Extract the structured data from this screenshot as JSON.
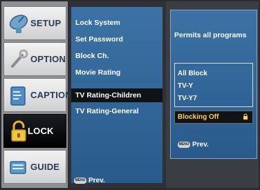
{
  "sidebar": {
    "items": [
      {
        "label": "SETUP",
        "icon": "satellite-dish-icon"
      },
      {
        "label": "OPTION",
        "icon": "wrench-icon"
      },
      {
        "label": "CAPTION",
        "icon": "caption-icon"
      },
      {
        "label": "LOCK",
        "icon": "padlock-icon",
        "active": true
      },
      {
        "label": "GUIDE",
        "icon": "guide-icon"
      }
    ]
  },
  "lock_menu": {
    "items": [
      "Lock System",
      "Set Password",
      "Block Ch.",
      "Movie Rating",
      "TV Rating-Children",
      "TV Rating-General"
    ],
    "selected_index": 4
  },
  "right_panel": {
    "description": "Permits all programs",
    "options": [
      "All Block",
      "TV-Y",
      "TV-Y7"
    ],
    "selected_option": "Blocking Off"
  },
  "footer": {
    "menu_button": "MENU",
    "prev_label": "Prev."
  },
  "colors": {
    "menu_blue": "#3c72a5",
    "highlight_yellow": "#ffd24a",
    "selected_bg": "#101214"
  }
}
